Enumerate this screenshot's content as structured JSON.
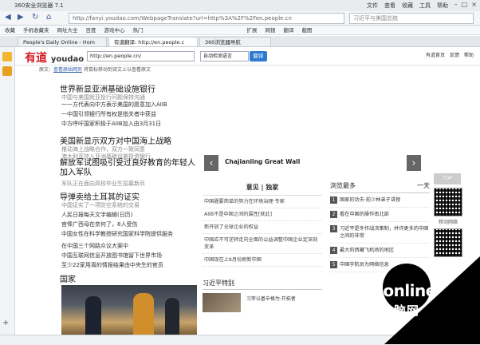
{
  "browser": {
    "app_title": "360安全浏览器 7.1",
    "menu": [
      "文件",
      "查看",
      "收藏",
      "工具",
      "帮助"
    ],
    "url": "http://fanyi.youdao.com/WebpageTranslate?url=http%3A%2F%2Fen.people.cn",
    "search_placeholder": "习近平与美国总统",
    "bookmarks": [
      "收藏",
      "手机收藏夹",
      "网址大全",
      "百度",
      "游戏中心",
      "热门",
      "扩展",
      "网银",
      "翻译",
      "截图"
    ],
    "tabs": [
      {
        "label": "People's Daily Online - Hom",
        "active": false
      },
      {
        "label": "有道翻译: http://en.people.c",
        "active": true
      },
      {
        "label": "360浏览器导航",
        "active": false
      }
    ]
  },
  "youdao": {
    "logo": "有道",
    "logo_sub": "youdao",
    "url_value": "http://en.people.cn/",
    "lang_select": "自动检测语言",
    "translate_button": "翻译",
    "links": [
      "有道首页",
      "反馈",
      "帮助"
    ],
    "sub_prefix": "原文：",
    "sub_link": "查看原始网页",
    "sub_suffix": "  将鼠标移动到译文上以查看原文"
  },
  "news": {
    "blocks": [
      {
        "head": "世界新显亚洲基础设施银行",
        "lines": [
          {
            "text": "中国与美国就亚投行问题保持沟通",
            "gray": true
          },
          {
            "text": "一一方代表向中方表示美国的愿意加入AIIB",
            "gray": false
          },
          {
            "text": "一中国引领银行所有权是指关者中获益",
            "gray": false
          },
          {
            "text": "中方呼吁国家积极于AIIB加入由3月31日",
            "gray": false
          }
        ]
      },
      {
        "head": "美国新显示双方对中国海上战略",
        "lines": [
          {
            "text": "推动海上战略合作，双方一致同意",
            "gray": true
          },
          {
            "text": "澳大利亚加入亚洲基础设施投资银行",
            "gray": true
          }
        ]
      },
      {
        "head": "解放军试图吸引受过良好教育的年轻人加入军队",
        "lines": [
          {
            "text": "军队正在面向高校毕业生招募新兵",
            "gray": true
          }
        ]
      },
      {
        "head": "导弹卖给土耳其的证实",
        "lines": [
          {
            "text": "中国证实了一项防空系统的交易",
            "gray": true
          },
          {
            "text": "人民日报每天文字编辑(日历)",
            "gray": false
          },
          {
            "text": "官俸广西母在奈何了，8人受伤",
            "gray": false
          },
          {
            "text": "中国女性在科学教授研究国家科学院提供服务",
            "gray": false
          },
          {
            "text": "在中国三个网路众议大案中",
            "gray": false
          },
          {
            "text": "中国互联网信息开放图书馆留下世界市场",
            "gray": false
          },
          {
            "text": "至少22家用周的情报结果由中央生的官员",
            "gray": false
          }
        ]
      },
      {
        "head": "国家",
        "lines": []
      }
    ]
  },
  "slider": {
    "caption": "Chajianling Great Wall",
    "prev_arrow": "‹",
    "next_arrow": "›"
  },
  "opinion": {
    "title": "意见 | 独家",
    "items": [
      "中国霾要简单的努力在环境治理·专家",
      "AIIB不是中国之间的属性[就此]",
      "新开放了全球企业的权益",
      "中国应不可逆转走向全面的公益调整中国企业定深刻变革",
      "中国现在上8月份刷新中国"
    ]
  },
  "most_viewed": {
    "title": "浏览最多",
    "period": "一天",
    "items": [
      "国家的功夫·前少林弟子讲授",
      "看在中国的操作南北部",
      "习近平是冬作战决策制，并许更多的中国之间的非常",
      "最大的西藏飞机场的地区",
      "中国宇航员为网络信息"
    ]
  },
  "xijin": {
    "title": "习近平特别",
    "item": "习李以基辛格为·开拓者"
  },
  "side": {
    "top_label": "TOP",
    "qr_label": "移动网络"
  },
  "watermark": {
    "brand": "PConline",
    "cn": "太平洋电脑网"
  }
}
